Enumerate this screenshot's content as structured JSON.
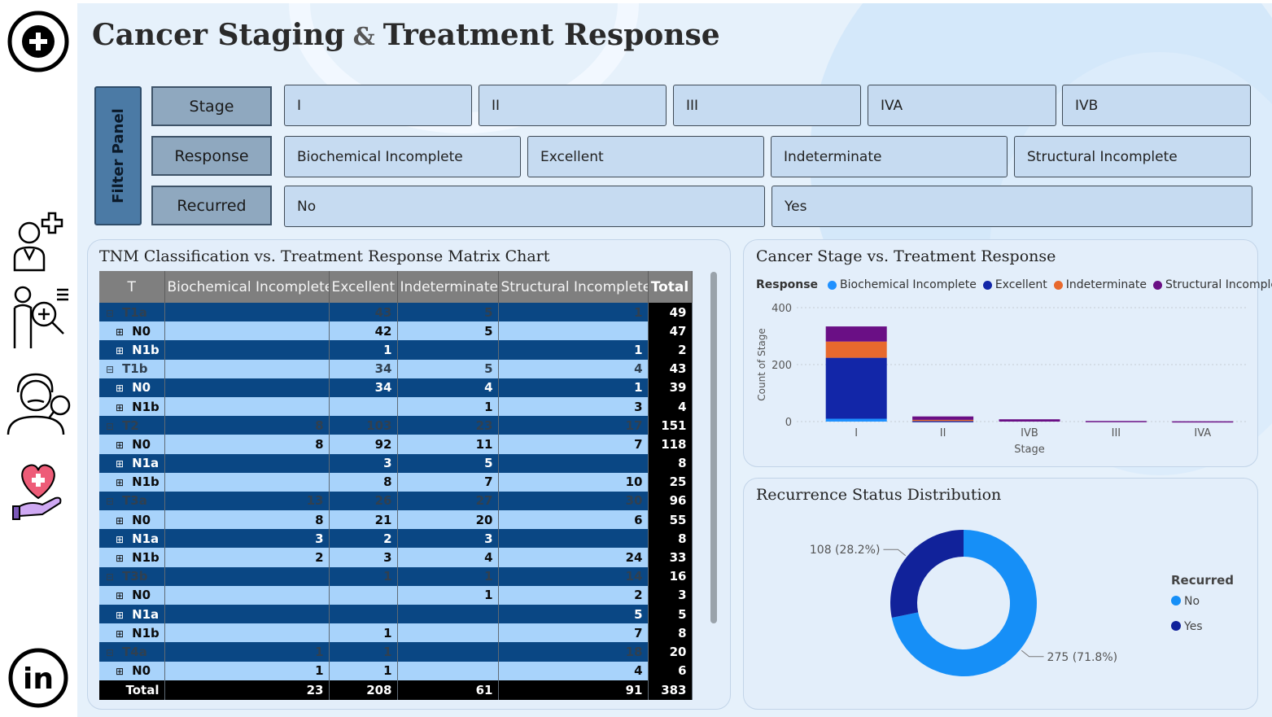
{
  "header": {
    "title_part1": "Cancer Staging",
    "ampersand": "&",
    "title_part2": "Treatment Response"
  },
  "nav": {
    "items": [
      {
        "name": "add-medical-icon"
      },
      {
        "name": "doctor-add-icon"
      },
      {
        "name": "doctor-search-icon"
      },
      {
        "name": "physician-magnify-icon"
      },
      {
        "name": "heart-care-icon"
      },
      {
        "name": "linkedin-icon"
      }
    ]
  },
  "filters": {
    "panel_label": "Filter Panel",
    "stage": {
      "label": "Stage",
      "options": [
        "I",
        "II",
        "III",
        "IVA",
        "IVB"
      ]
    },
    "response": {
      "label": "Response",
      "options": [
        "Biochemical Incomplete",
        "Excellent",
        "Indeterminate",
        "Structural Incomplete"
      ]
    },
    "recurred": {
      "label": "Recurred",
      "options": [
        "No",
        "Yes"
      ]
    }
  },
  "matrix": {
    "title": "TNM Classification vs. Treatment Response Matrix Chart",
    "columns": [
      "T",
      "Biochemical Incomplete",
      "Excellent",
      "Indeterminate",
      "Structural Incomplete",
      "Total"
    ],
    "rows": [
      {
        "label": "T1a",
        "level": 0,
        "toggle": "⊟",
        "values": [
          "",
          "43",
          "5",
          "1",
          "49"
        ]
      },
      {
        "label": "N0",
        "level": 1,
        "toggle": "⊞",
        "values": [
          "",
          "42",
          "5",
          "",
          "47"
        ]
      },
      {
        "label": "N1b",
        "level": 1,
        "toggle": "⊞",
        "values": [
          "",
          "1",
          "",
          "1",
          "2"
        ]
      },
      {
        "label": "T1b",
        "level": 0,
        "toggle": "⊟",
        "values": [
          "",
          "34",
          "5",
          "4",
          "43"
        ]
      },
      {
        "label": "N0",
        "level": 1,
        "toggle": "⊞",
        "values": [
          "",
          "34",
          "4",
          "1",
          "39"
        ]
      },
      {
        "label": "N1b",
        "level": 1,
        "toggle": "⊞",
        "values": [
          "",
          "",
          "1",
          "3",
          "4"
        ]
      },
      {
        "label": "T2",
        "level": 0,
        "toggle": "⊟",
        "values": [
          "8",
          "103",
          "23",
          "17",
          "151"
        ]
      },
      {
        "label": "N0",
        "level": 1,
        "toggle": "⊞",
        "values": [
          "8",
          "92",
          "11",
          "7",
          "118"
        ]
      },
      {
        "label": "N1a",
        "level": 1,
        "toggle": "⊞",
        "values": [
          "",
          "3",
          "5",
          "",
          "8"
        ]
      },
      {
        "label": "N1b",
        "level": 1,
        "toggle": "⊞",
        "values": [
          "",
          "8",
          "7",
          "10",
          "25"
        ]
      },
      {
        "label": "T3a",
        "level": 0,
        "toggle": "⊟",
        "values": [
          "13",
          "26",
          "27",
          "30",
          "96"
        ]
      },
      {
        "label": "N0",
        "level": 1,
        "toggle": "⊞",
        "values": [
          "8",
          "21",
          "20",
          "6",
          "55"
        ]
      },
      {
        "label": "N1a",
        "level": 1,
        "toggle": "⊞",
        "values": [
          "3",
          "2",
          "3",
          "",
          "8"
        ]
      },
      {
        "label": "N1b",
        "level": 1,
        "toggle": "⊞",
        "values": [
          "2",
          "3",
          "4",
          "24",
          "33"
        ]
      },
      {
        "label": "T3b",
        "level": 0,
        "toggle": "⊟",
        "values": [
          "",
          "1",
          "1",
          "14",
          "16"
        ]
      },
      {
        "label": "N0",
        "level": 1,
        "toggle": "⊞",
        "values": [
          "",
          "",
          "1",
          "2",
          "3"
        ]
      },
      {
        "label": "N1a",
        "level": 1,
        "toggle": "⊞",
        "values": [
          "",
          "",
          "",
          "5",
          "5"
        ]
      },
      {
        "label": "N1b",
        "level": 1,
        "toggle": "⊞",
        "values": [
          "",
          "1",
          "",
          "7",
          "8"
        ]
      },
      {
        "label": "T4a",
        "level": 0,
        "toggle": "⊟",
        "values": [
          "1",
          "1",
          "",
          "18",
          "20"
        ]
      },
      {
        "label": "N0",
        "level": 1,
        "toggle": "⊞",
        "values": [
          "1",
          "1",
          "",
          "4",
          "6"
        ]
      }
    ],
    "total": {
      "label": "Total",
      "values": [
        "23",
        "208",
        "61",
        "91",
        "383"
      ]
    }
  },
  "colors": {
    "biochemical": "#1e90ff",
    "excellent": "#1226a8",
    "indeterminate": "#e8692d",
    "structural": "#6a0f85",
    "no": "#168ff7",
    "yes": "#11229a"
  },
  "chart_data": [
    {
      "type": "bar",
      "stacked": true,
      "title": "Cancer Stage vs. Treatment Response",
      "legend_title": "Response",
      "legend_position": "top-left",
      "categories": [
        "I",
        "II",
        "IVB",
        "III",
        "IVA"
      ],
      "series": [
        {
          "name": "Biochemical Incomplete",
          "color": "#1e90ff",
          "values": [
            10,
            0,
            0,
            0,
            0
          ]
        },
        {
          "name": "Excellent",
          "color": "#1226a8",
          "values": [
            214,
            2,
            0,
            0,
            0
          ]
        },
        {
          "name": "Indeterminate",
          "color": "#e8692d",
          "values": [
            57,
            4,
            0,
            0,
            0
          ]
        },
        {
          "name": "Structural Incomplete",
          "color": "#6a0f85",
          "values": [
            53,
            12,
            8,
            2,
            1
          ]
        }
      ],
      "xlabel": "Stage",
      "ylabel": "Count of Stage",
      "ylim": [
        0,
        400
      ],
      "yticks": [
        "0",
        "200",
        "400"
      ],
      "grid": true
    },
    {
      "type": "pie",
      "donut": true,
      "title": "Recurrence Status Distribution",
      "legend_title": "Recurred",
      "legend_position": "right",
      "slices": [
        {
          "name": "No",
          "value": 275,
          "label": "275 (71.8%)",
          "color": "#168ff7"
        },
        {
          "name": "Yes",
          "value": 108,
          "label": "108 (28.2%)",
          "color": "#11229a"
        }
      ]
    }
  ]
}
